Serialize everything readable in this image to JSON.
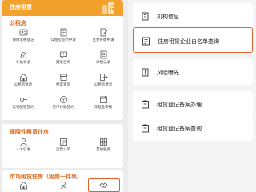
{
  "banner": {
    "title": "住房租赁"
  },
  "sections": {
    "public_housing": {
      "title": "公租房",
      "items": [
        {
          "label": "保障资格登记",
          "icon": "id-card-icon"
        },
        {
          "label": "公租房签约申请",
          "icon": "contract-icon"
        },
        {
          "label": "变更补缴申请",
          "icon": "document-edit-icon"
        },
        {
          "label": "补贴补录",
          "icon": "money-bag-icon"
        },
        {
          "label": "疑难咨询",
          "icon": "chat-question-icon"
        },
        {
          "label": "承租记录",
          "icon": "record-icon"
        },
        {
          "label": "公租房体验",
          "icon": "house-icon"
        },
        {
          "label": "档案查询",
          "icon": "archive-icon"
        },
        {
          "label": "公租房退出",
          "icon": "exit-icon"
        },
        {
          "label": "实物配租签约",
          "icon": "key-icon"
        },
        {
          "label": "货币补贴签约",
          "icon": "coin-icon"
        },
        {
          "label": "年租金审核",
          "icon": "calendar-icon"
        }
      ]
    },
    "guaranteed_rental": {
      "title": "保障性租赁住房",
      "items": [
        {
          "label": "人才引进",
          "icon": "talent-icon"
        },
        {
          "label": "运营公示",
          "icon": "notice-icon"
        },
        {
          "label": "其他服务",
          "icon": "more-icon"
        }
      ]
    },
    "market_rental": {
      "title": "市场租赁住房（租房一件事）",
      "items": [
        {
          "label": "",
          "icon": "house-icon"
        },
        {
          "label": "",
          "icon": "person-icon"
        },
        {
          "label": "",
          "icon": "handshake-icon"
        }
      ]
    }
  },
  "right_menu": [
    {
      "label": "机构信息",
      "icon": "building-icon",
      "active": false
    },
    {
      "label": "住房租赁企业白名单查询",
      "icon": "list-search-icon",
      "active": true
    },
    {
      "label": "风险曝光",
      "icon": "warning-icon",
      "active": false
    },
    {
      "label": "租赁登记备案办理",
      "icon": "register-icon",
      "active": false
    },
    {
      "label": "租赁登记备案查询",
      "icon": "register-search-icon",
      "active": false
    }
  ],
  "colors": {
    "accent": "#f3a12d",
    "section_title": "#e06b1f",
    "highlight_border": "#e2602c"
  }
}
